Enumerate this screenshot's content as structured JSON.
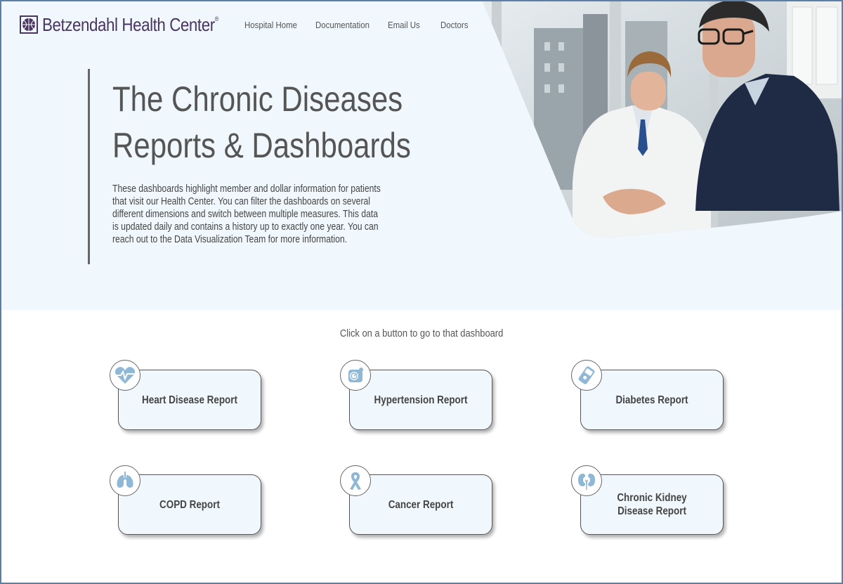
{
  "header": {
    "logo_text": "Betzendahl Health Center",
    "logo_mark": "®",
    "nav": [
      "Hospital Home",
      "Documentation",
      "Email Us",
      "Doctors"
    ]
  },
  "hero": {
    "title_line1": "The Chronic Diseases",
    "title_line2": "Reports & Dashboards",
    "description": "These dashboards highlight member and dollar information for patients that visit our Health Center. You can filter the dashboards on several different dimensions and switch between multiple measures. This data is updated daily and contains a history up to exactly one year. You can reach out to the Data Visualization Team for more information."
  },
  "prompt": "Click on a button to go to that dashboard",
  "cards": [
    {
      "label": "Heart Disease Report",
      "icon": "heart-pulse-icon"
    },
    {
      "label": "Hypertension Report",
      "icon": "blood-pressure-icon"
    },
    {
      "label": "Diabetes Report",
      "icon": "glucose-meter-icon"
    },
    {
      "label": "COPD Report",
      "icon": "lungs-icon"
    },
    {
      "label": "Cancer Report",
      "icon": "awareness-ribbon-icon"
    },
    {
      "label": "Chronic Kidney Disease Report",
      "icon": "kidneys-icon"
    }
  ],
  "colors": {
    "brand": "#4a3560",
    "hero_bg": "#f1f8fd",
    "icon_blue": "#8fb8d6",
    "frame": "#5b7fa8"
  }
}
